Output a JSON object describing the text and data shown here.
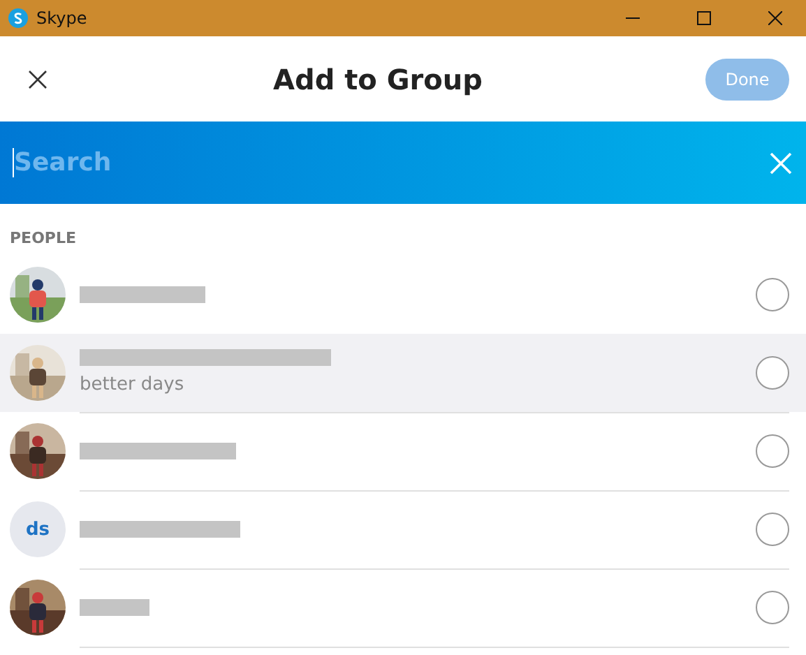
{
  "window": {
    "title": "Skype"
  },
  "header": {
    "title": "Add to Group",
    "done_button": "Done",
    "done_disabled": true
  },
  "search": {
    "placeholder": "Search"
  },
  "section": {
    "label": "PEOPLE"
  },
  "contacts": [
    {
      "redacted": true,
      "selected": false,
      "checked": false
    },
    {
      "redacted": true,
      "status": "better days",
      "selected": true,
      "checked": false
    },
    {
      "redacted": true,
      "selected": false,
      "checked": false
    },
    {
      "avatar": {
        "kind": "initials",
        "initials": "ds"
      },
      "redacted": true,
      "selected": false,
      "checked": false
    },
    {
      "redacted": true,
      "selected": false,
      "checked": false
    }
  ]
}
